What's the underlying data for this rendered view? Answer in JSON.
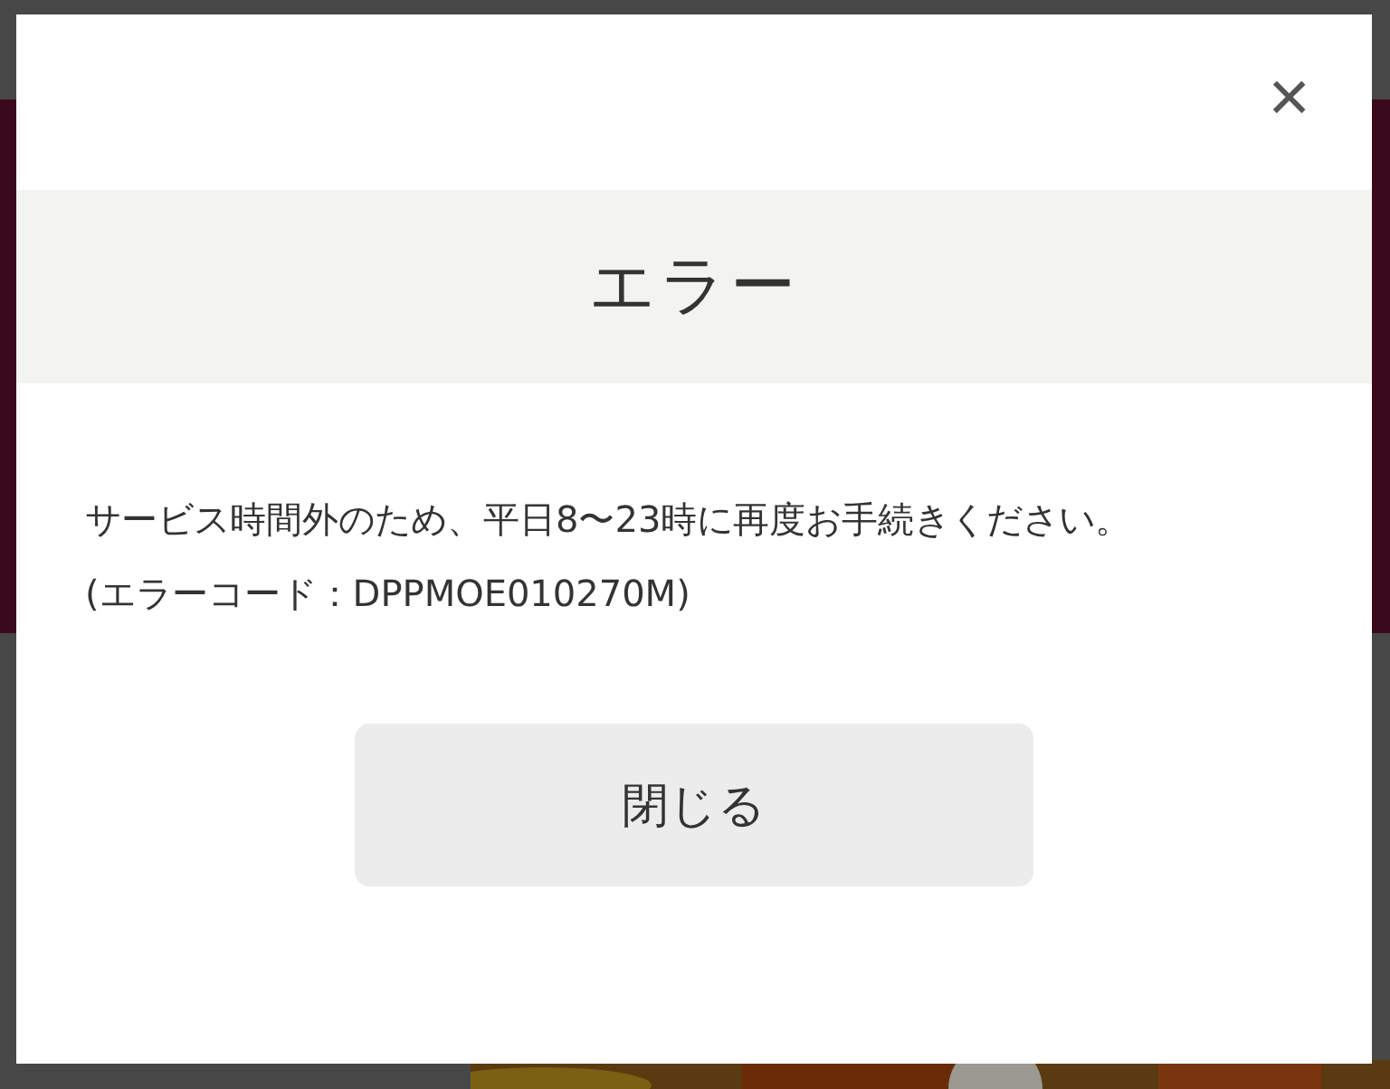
{
  "dialog": {
    "close_icon": "×",
    "title": "エラー",
    "message": "サービス時間外のため、平日8〜23時に再度お手続きください。",
    "error_code": "(エラーコード：DPPMOE010270M)",
    "button": "閉じる"
  }
}
